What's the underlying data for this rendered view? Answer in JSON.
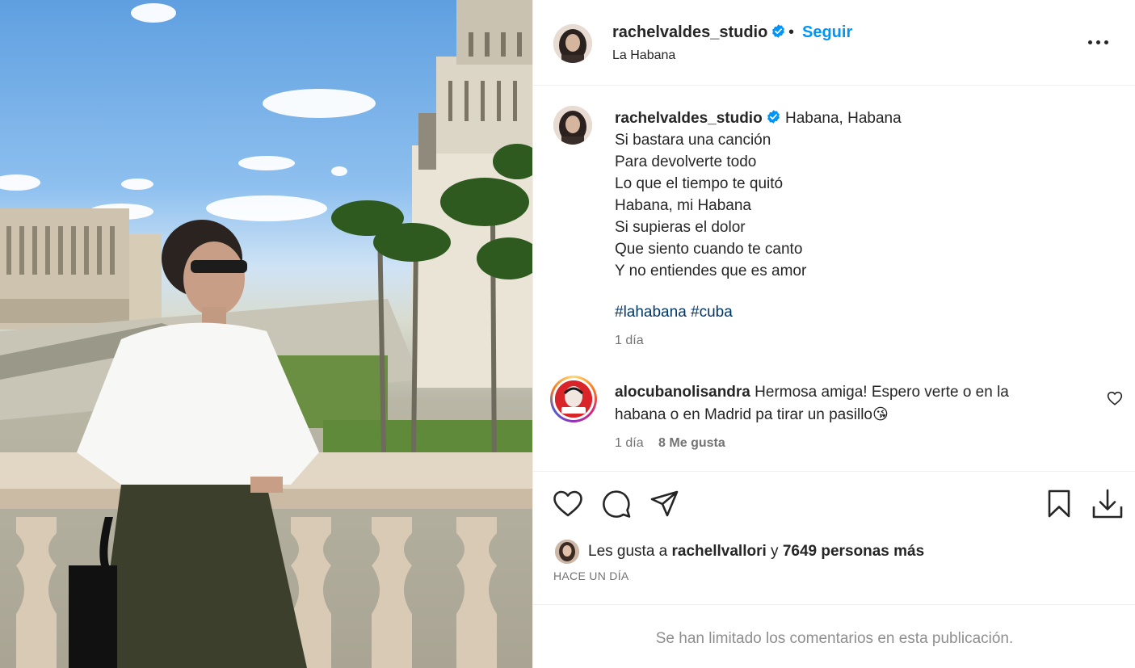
{
  "post": {
    "username": "rachelvaldes_studio",
    "separator": "•",
    "follow_label": "Seguir",
    "location": "La Habana"
  },
  "caption": {
    "username": "rachelvaldes_studio",
    "first_line": "Habana, Habana",
    "lines": [
      "Si bastara una canción",
      "Para devolverte todo",
      "Lo que el tiempo te quitó",
      "Habana, mi Habana",
      "Si supieras el dolor",
      "Que siento cuando te canto",
      "Y no entiendes que es amor"
    ],
    "hashtags": [
      "#lahabana",
      "#cuba"
    ],
    "time": "1 día"
  },
  "comment": {
    "username": "alocubanolisandra",
    "text": "Hermosa amiga! Espero verte o en la habana o en Madrid pa tirar un pasillo😘",
    "time": "1 día",
    "likes": "8 Me gusta"
  },
  "actions": {
    "icons": [
      "heart-icon",
      "comment-icon",
      "share-icon",
      "bookmark-icon",
      "download-icon"
    ]
  },
  "likes_summary": {
    "prefix": "Les gusta a",
    "user": "rachellvallori",
    "joiner": "y",
    "others": "7649 personas más"
  },
  "timestamp": "HACE UN DÍA",
  "comments_limited": "Se han limitado los comentarios en esta publicación.",
  "colors": {
    "accent": "#0095f6",
    "text": "#262626",
    "muted": "#737373",
    "hashtag": "#00376b",
    "verified": "#0095f6"
  }
}
